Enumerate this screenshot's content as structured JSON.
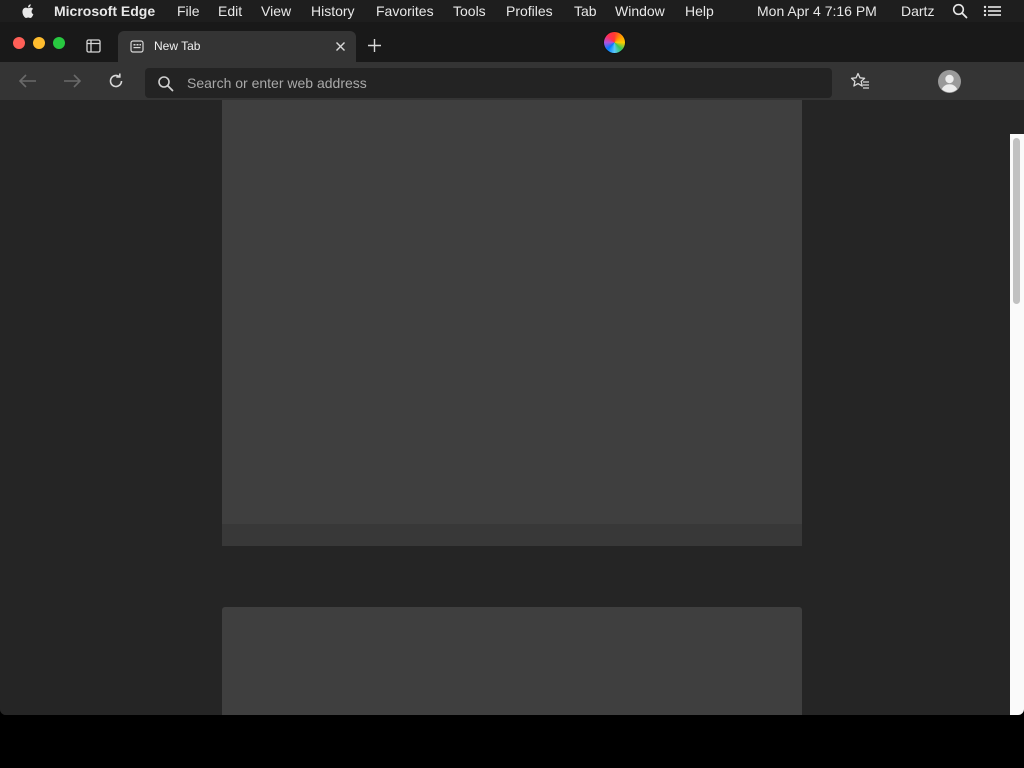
{
  "menubar": {
    "app_name": "Microsoft Edge",
    "items": [
      "File",
      "Edit",
      "View",
      "History",
      "Favorites",
      "Tools",
      "Profiles",
      "Tab",
      "Window",
      "Help"
    ],
    "clock": "Mon Apr 4  7:16 PM",
    "user": "Dartz",
    "icons": [
      "apple-icon",
      "spotlight-icon",
      "control-center-icon"
    ]
  },
  "tab": {
    "title": "New Tab",
    "icons": [
      "new-tab-favicon",
      "tab-close-icon"
    ]
  },
  "toolbar": {
    "address_placeholder": "Search or enter web address",
    "address_value": "",
    "icons": [
      "back-arrow-icon",
      "forward-arrow-icon",
      "reload-icon",
      "search-icon",
      "favorites-icon",
      "profile-icon"
    ]
  },
  "colors": {
    "menubar_bg": "#1e1e1e",
    "tabbar_bg": "#191919",
    "toolbar_bg": "#343434",
    "content_bg": "#252525",
    "panel_bg": "#3f3f3f",
    "close": "#fe5f57",
    "minimize": "#febc2e",
    "maximize": "#28c840"
  }
}
